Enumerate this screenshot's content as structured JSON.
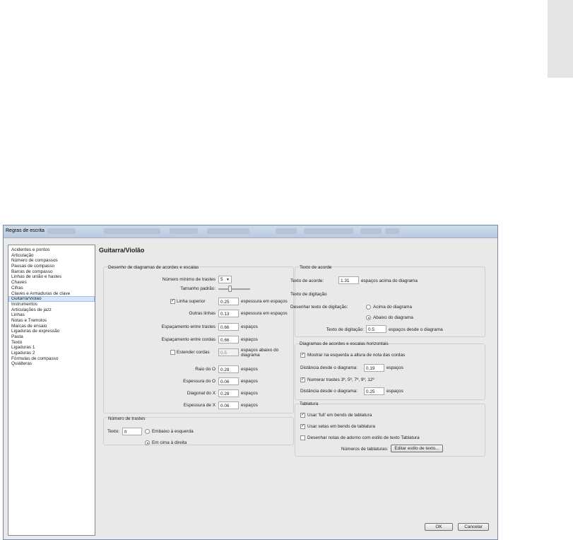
{
  "dialog": {
    "title": "Regras de escrita",
    "page_title": "Guitarra/Violão",
    "categories": [
      "Acidentes e pontos",
      "Articulação",
      "Número de compassos",
      "Pausas de compasso",
      "Barras de compasso",
      "Linhas de união e hastes",
      "Chaves",
      "Cifras",
      "Claves e Armaduras de clave",
      "Guitarra/Violão",
      "Instrumentos",
      "Articulações de jazz",
      "Linhas",
      "Notas e Tremolos",
      "Marcas de ensaio",
      "Ligaduras de expressão",
      "Pauta",
      "Texto",
      "Ligaduras 1",
      "Ligaduras 2",
      "Fórmulas de compasso",
      "Quiálteras"
    ],
    "selected_category_index": 9
  },
  "chord_diagrams": {
    "title": "Desenho de diagramas de acordes e escalas",
    "min_frets_label": "Número mínimo de trastes",
    "min_frets_value": "5",
    "default_size_label": "Tamanho padrão:",
    "top_line_label": "Linha superior",
    "top_line_checked": true,
    "top_line_value": "0.25",
    "thickness_units": "espessura em espaços",
    "other_lines_label": "Outras linhas",
    "other_lines_value": "0.13",
    "fret_spacing_label": "Espaçamento entre trastes",
    "fret_spacing_value": "0.66",
    "string_spacing_label": "Espaçamento entre cordas",
    "string_spacing_value": "0.66",
    "units": "espaços",
    "extend_strings_label": "Estender cordas",
    "extend_strings_checked": false,
    "extend_strings_value": "0.5",
    "extend_strings_units": "espaços abaixo do diagrama",
    "o_radius_label": "Raio do O",
    "o_radius_value": "0.28",
    "o_thickness_label": "Espessura do O",
    "o_thickness_value": "0.06",
    "x_diagonal_label": "Diagonal do X",
    "x_diagonal_value": "0.28",
    "x_thickness_label": "Espessura de X",
    "x_thickness_value": "0.06"
  },
  "fret_number": {
    "title": "Número de trastes",
    "text_label": "Texto:",
    "text_value": "fr",
    "option_bottom_left": "Embaixo à esquerda",
    "option_top_right": "Em cima à direita",
    "selected": "top_right"
  },
  "chord_text": {
    "title": "Texto de acorde",
    "label": "Texto de acorde:",
    "value": "1.31",
    "units": "espaços acima do diagrama"
  },
  "fingering_text": {
    "title": "Texto de digitação",
    "draw_label": "Desenhar texto de digitação:",
    "option_above": "Acima do diagrama",
    "option_below": "Abaixo do diagrama",
    "selected": "below",
    "text_label": "Texto de digitação:",
    "text_value": "0.5",
    "text_units": "espaços desde o diagrama"
  },
  "horizontal": {
    "title": "Diagramas de acordes e escalas horizontais",
    "show_left_label": "Mostrar na esquerda a altura de nota das cordas",
    "show_left_checked": true,
    "distance_label": "Distância desde o diagrama:",
    "distance1_value": "0.19",
    "units": "espaços",
    "number_frets_label": "Numerar trastes 3º, 5º, 7º, 9º, 12º",
    "number_frets_checked": true,
    "distance2_value": "0.25"
  },
  "tablature": {
    "title": "Tablatura",
    "full_label": "Usar 'full' em bends de tablatura",
    "full_checked": true,
    "arrows_label": "Usar setas em bends de tablatura",
    "arrows_checked": true,
    "grace_label": "Desenhar notas de adorno com estilo de texto Tablatura",
    "grace_checked": false,
    "numbers_label": "Números de tablaturas:",
    "edit_style_button": "Editar estilo de texto..."
  },
  "buttons": {
    "ok": "OK",
    "cancel": "Cancelar"
  }
}
